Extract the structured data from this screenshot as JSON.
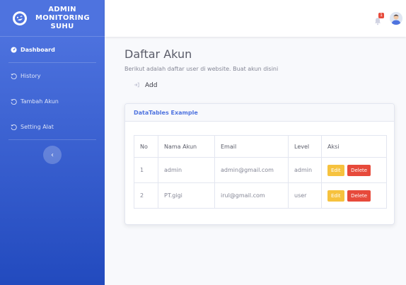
{
  "sidebar": {
    "brand": "ADMIN\nMONITORING\nSUHU",
    "items": [
      {
        "label": "Dashboard",
        "icon": "tachometer-icon",
        "active": true
      },
      {
        "label": "History",
        "icon": "history-icon"
      },
      {
        "label": "Tambah Akun",
        "icon": "history-icon"
      },
      {
        "label": "Setting Alat",
        "icon": "history-icon"
      }
    ],
    "toggle_glyph": "‹"
  },
  "topbar": {
    "alert_count": "1"
  },
  "main": {
    "title": "Daftar Akun",
    "description": "Berikut adalah daftar user di website. Buat akun disini",
    "add_label": "Add",
    "card_title": "DataTables Example",
    "table": {
      "headers": [
        "No",
        "Nama Akun",
        "Email",
        "Level",
        "Aksi"
      ],
      "rows": [
        {
          "no": "1",
          "name": "admin",
          "email": "admin@gmail.com",
          "level": "admin"
        },
        {
          "no": "2",
          "name": "PT.gigi",
          "email": "irul@gmail.com",
          "level": "user"
        }
      ],
      "edit_label": "Edit",
      "delete_label": "Delete"
    }
  },
  "colors": {
    "primary": "#4e73df",
    "warning": "#f6c23e",
    "danger": "#e74a3b"
  }
}
